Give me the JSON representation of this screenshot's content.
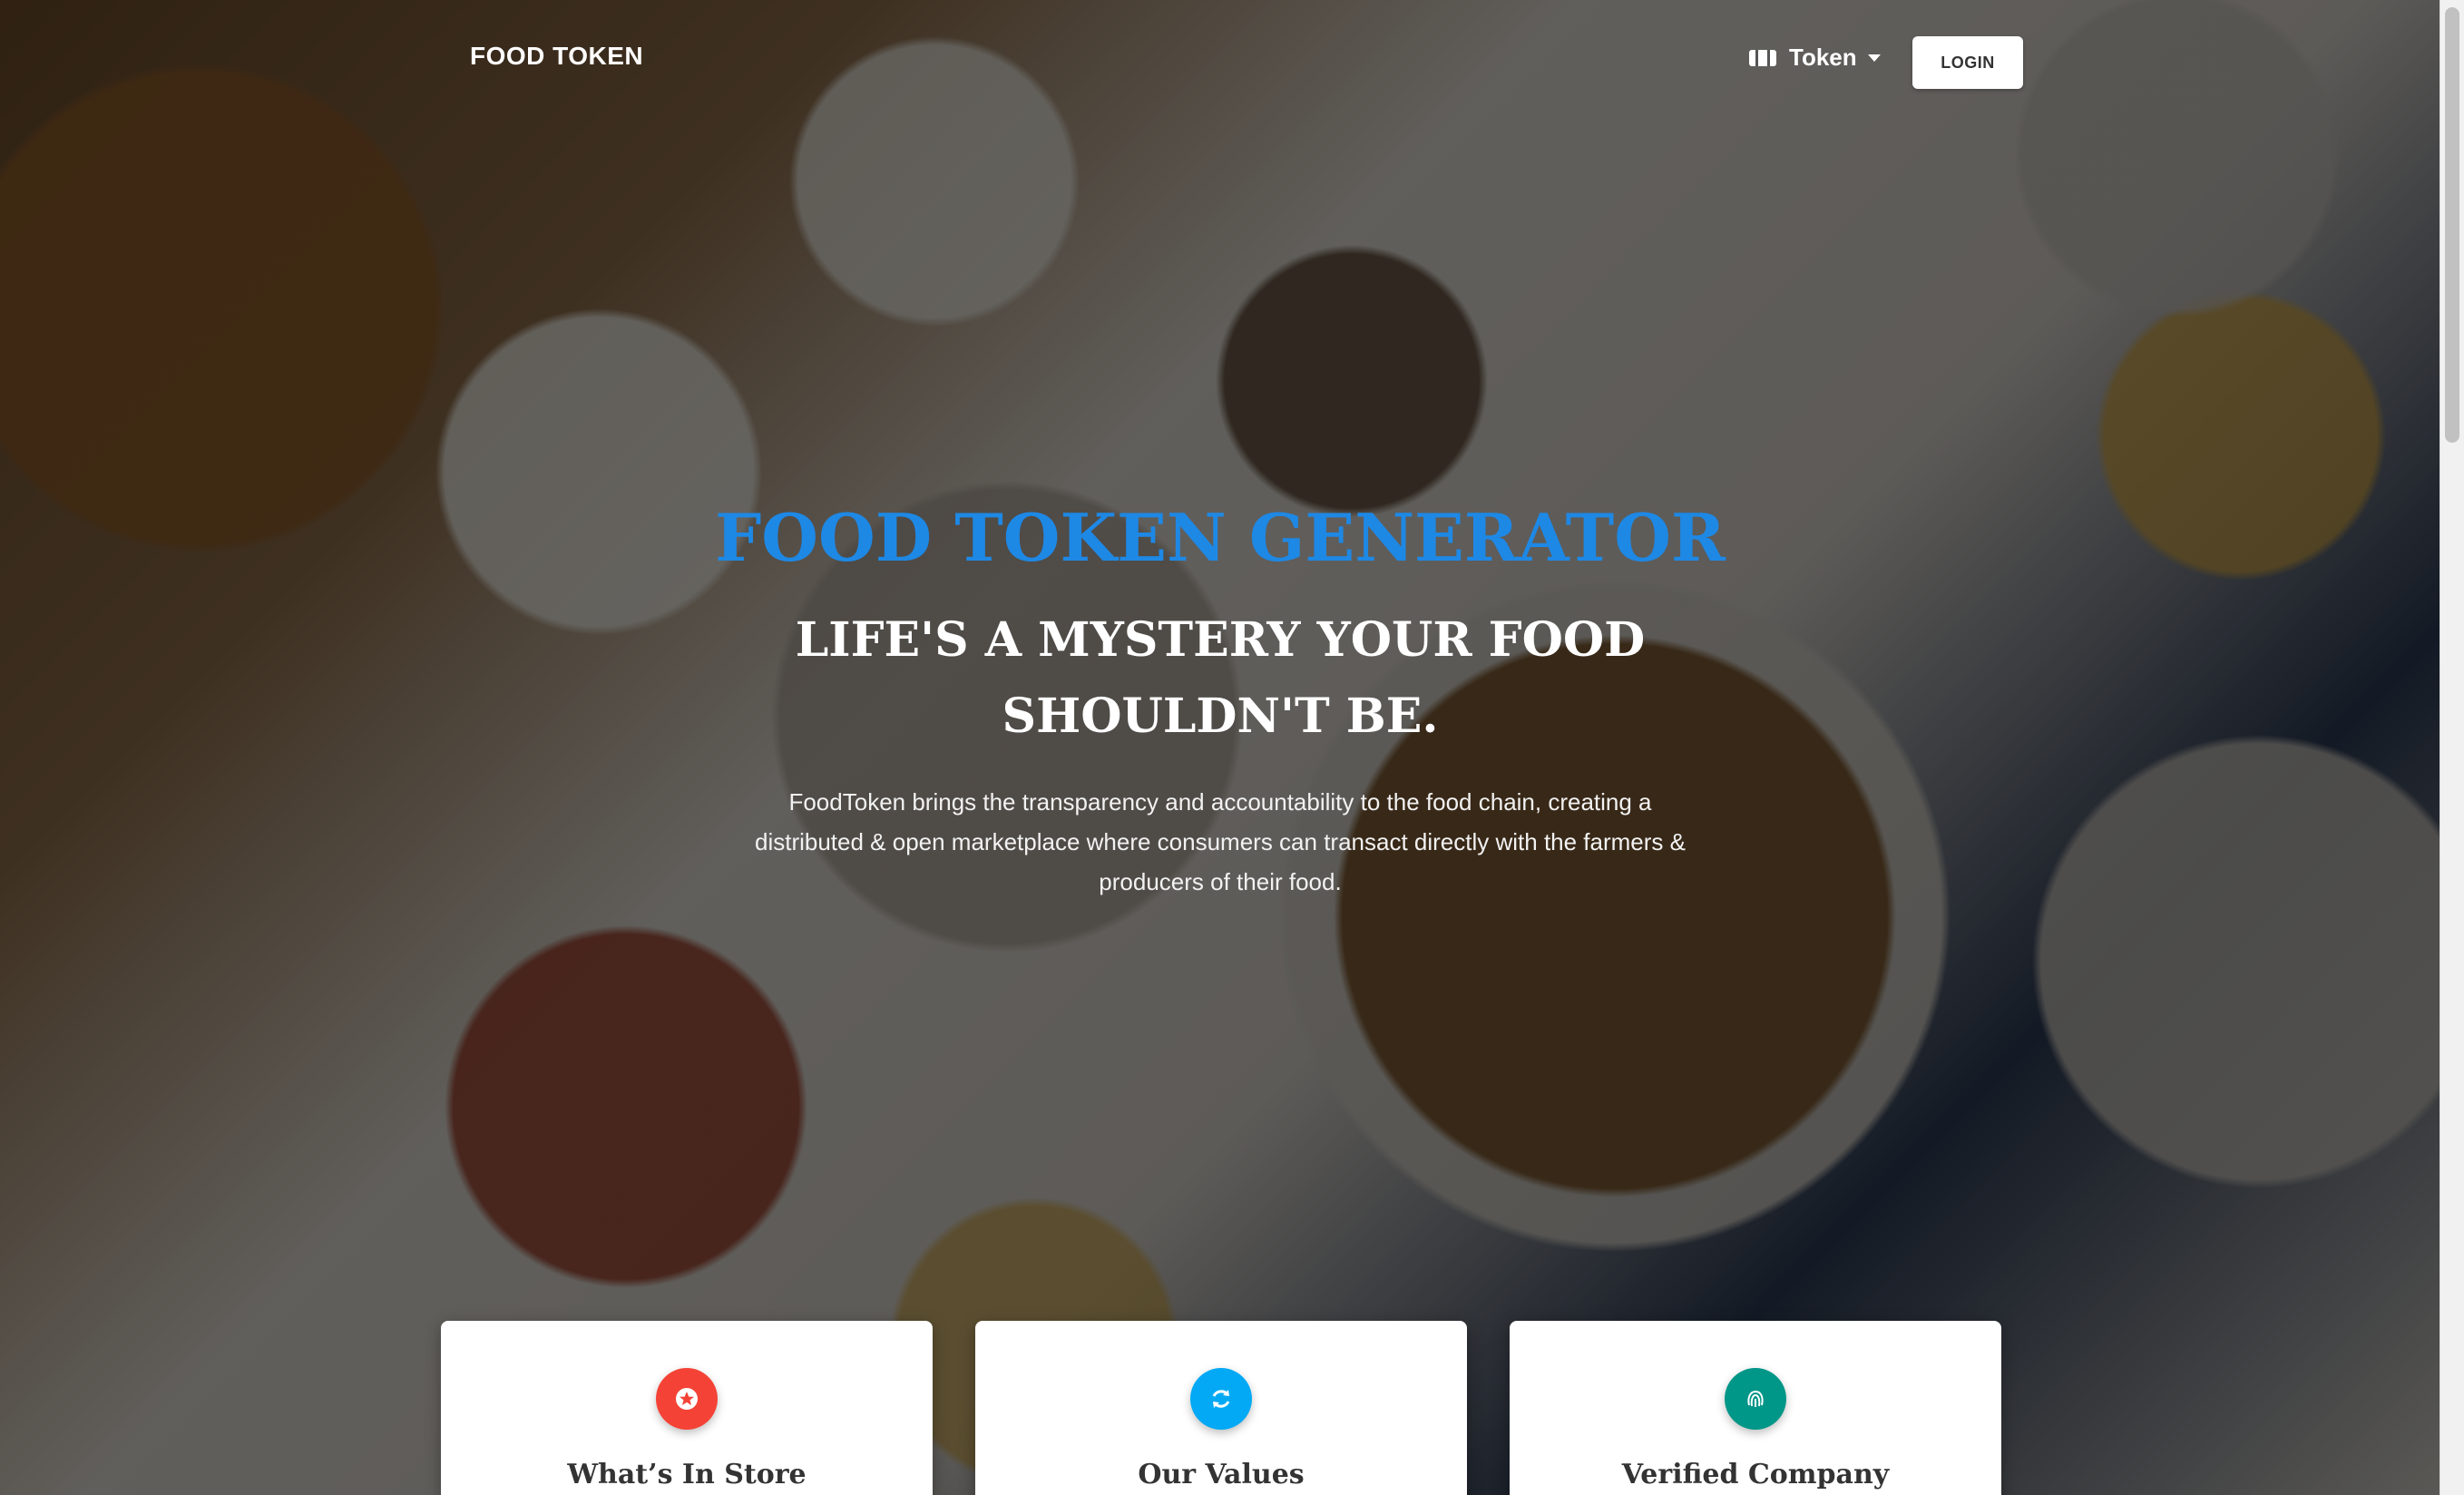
{
  "navbar": {
    "brand": "FOOD TOKEN",
    "token_label": "Token",
    "login_label": "LOGIN"
  },
  "hero": {
    "title": "FOOD TOKEN GENERATOR",
    "subtitle": "LIFE'S A MYSTERY YOUR FOOD SHOULDN'T BE.",
    "description": "FoodToken brings the transparency and accountability to the food chain, creating a distributed & open marketplace where consumers can transact directly with the farmers & producers of their food."
  },
  "features": [
    {
      "title": "What’s In Store",
      "icon": "star-icon",
      "color": "#f44336"
    },
    {
      "title": "Our Values",
      "icon": "refresh-icon",
      "color": "#03a9f4"
    },
    {
      "title": "Verified Company",
      "icon": "fingerprint-icon",
      "color": "#009688"
    }
  ],
  "colors": {
    "accent": "#1e88e5"
  }
}
